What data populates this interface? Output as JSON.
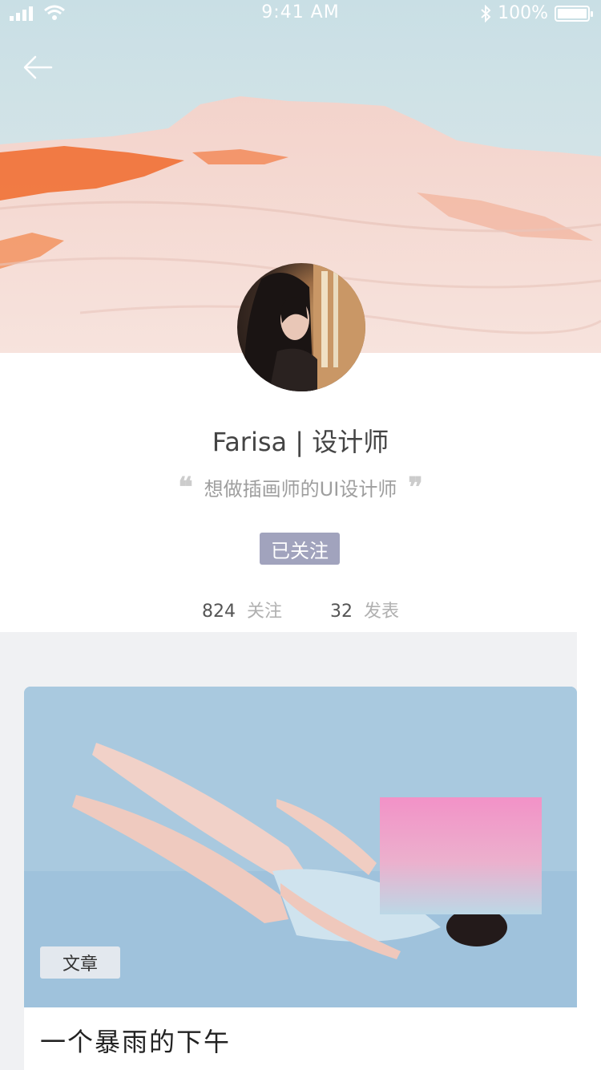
{
  "status_bar": {
    "time": "9:41 AM",
    "battery": "100%",
    "signal_icon": "signal-icon",
    "wifi_icon": "wifi-icon",
    "bluetooth_icon": "bluetooth-icon"
  },
  "header": {
    "back_icon": "back-arrow-icon"
  },
  "profile": {
    "name": "Farisa | 设计师",
    "bio": "想做插画师的UI设计师",
    "open_quote": "❝",
    "close_quote": "❞",
    "follow_button": "已关注",
    "stats": [
      {
        "value": "824",
        "label": "关注"
      },
      {
        "value": "32",
        "label": "发表"
      }
    ]
  },
  "feed": {
    "cards": [
      {
        "tag": "文章",
        "title": "一个暴雨的下午"
      }
    ]
  },
  "colors": {
    "accent": "#a1a3bd",
    "feed_bg": "#f0f1f3",
    "card_image_bg": "#a8c8df"
  }
}
